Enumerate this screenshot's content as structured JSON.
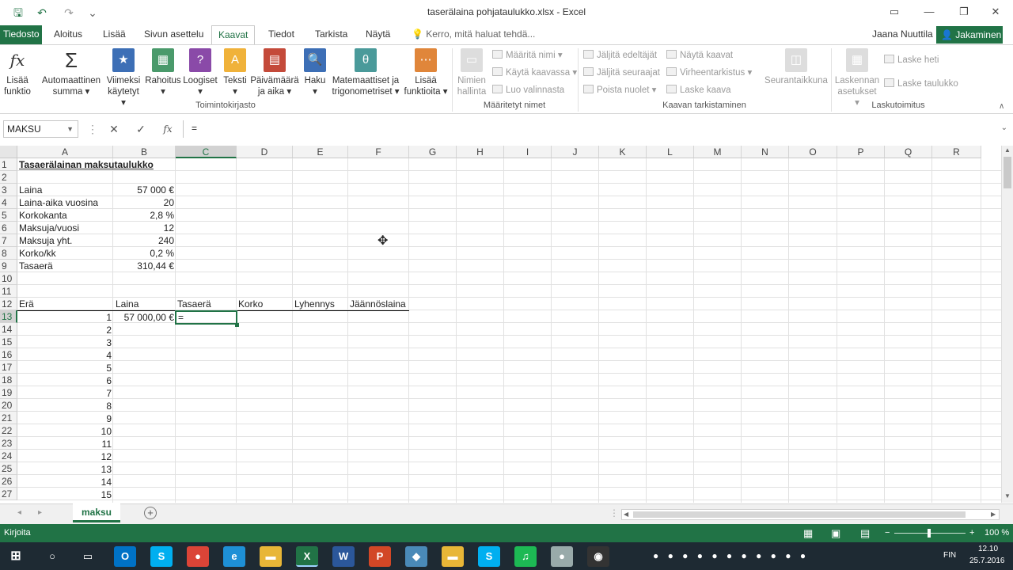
{
  "window": {
    "title": "taserälaina pohjataulukko.xlsx - Excel",
    "minimize": "—",
    "restore": "❐",
    "close": "✕",
    "ribbon_options": "▭"
  },
  "quick_access": {
    "save": "🖫",
    "undo": "↶",
    "redo": "↷",
    "customize": "⌄"
  },
  "tabs": [
    "Tiedosto",
    "Aloitus",
    "Lisää",
    "Sivun asettelu",
    "Kaavat",
    "Tiedot",
    "Tarkista",
    "Näytä"
  ],
  "active_tab": "Kaavat",
  "tell_me": "Kerro, mitä haluat tehdä...",
  "user": "Jaana Nuuttila",
  "share": "Jakaminen",
  "ribbon": {
    "insert_function": [
      "Lisää",
      "funktio"
    ],
    "lib": [
      [
        "Automaattinen",
        "summa ▾"
      ],
      [
        "Viimeksi",
        "käytetyt ▾"
      ],
      [
        "Rahoitus",
        "▾"
      ],
      [
        "Loogiset",
        "▾"
      ],
      [
        "Teksti",
        "▾"
      ],
      [
        "Päivämäärä",
        "ja aika ▾"
      ],
      [
        "Haku",
        "▾"
      ],
      [
        "Matemaattiset ja",
        "trigonometriset ▾"
      ],
      [
        "Lisää",
        "funktioita ▾"
      ]
    ],
    "group_library": "Toimintokirjasto",
    "name_manager": [
      "Nimien",
      "hallinta"
    ],
    "defined_names": [
      "Määritä nimi ▾",
      "Käytä kaavassa ▾",
      "Luo valinnasta"
    ],
    "group_names": "Määritetyt nimet",
    "audit_left": [
      "Jäljitä edeltäjät",
      "Jäljitä seuraajat",
      "Poista nuolet ▾"
    ],
    "audit_right": [
      "Näytä kaavat",
      "Virheentarkistus ▾",
      "Laske kaava"
    ],
    "watch": "Seurantaikkuna",
    "group_audit": "Kaavan tarkistaminen",
    "calc_options": [
      "Laskennan",
      "asetukset ▾"
    ],
    "calc": [
      "Laske heti",
      "Laske taulukko"
    ],
    "group_calc": "Laskutoimitus"
  },
  "formula_bar": {
    "name_box": "MAKSU",
    "formula": "="
  },
  "columns": [
    "A",
    "B",
    "C",
    "D",
    "E",
    "F",
    "G",
    "H",
    "I",
    "J",
    "K",
    "L",
    "M",
    "N",
    "O",
    "P",
    "Q",
    "R"
  ],
  "rows": [
    "1",
    "2",
    "3",
    "4",
    "5",
    "6",
    "7",
    "8",
    "9",
    "10",
    "11",
    "12",
    "13",
    "14",
    "15",
    "16",
    "17",
    "18",
    "19",
    "20",
    "21",
    "22",
    "23",
    "24",
    "25",
    "26",
    "27"
  ],
  "cells": {
    "title": "Tasaerälainan maksutaulukko",
    "params": [
      {
        "label": "Laina",
        "value": "57 000 €"
      },
      {
        "label": "Laina-aika vuosina",
        "value": "20"
      },
      {
        "label": "Korkokanta",
        "value": "2,8 %"
      },
      {
        "label": "Maksuja/vuosi",
        "value": "12"
      },
      {
        "label": "Maksuja yht.",
        "value": "240"
      },
      {
        "label": "Korko/kk",
        "value": "0,2 %"
      },
      {
        "label": "Tasaerä",
        "value": "310,44 €"
      }
    ],
    "headers": [
      "Erä",
      "Laina",
      "Tasaerä",
      "Korko",
      "Lyhennys",
      "Jäännöslaina"
    ],
    "first_loan": "57 000,00 €",
    "editing": "=",
    "erat": [
      "1",
      "2",
      "3",
      "4",
      "5",
      "6",
      "7",
      "8",
      "9",
      "10",
      "11",
      "12",
      "13",
      "14",
      "15"
    ]
  },
  "sheet_tab": "maksu",
  "status": {
    "mode": "Kirjoita",
    "zoom": "100 %"
  },
  "taskbar": {
    "apps": [
      {
        "name": "outlook",
        "label": "O",
        "color": "#0072c6"
      },
      {
        "name": "skype",
        "label": "S",
        "color": "#00aff0"
      },
      {
        "name": "chrome",
        "label": "●",
        "color": "#db4437"
      },
      {
        "name": "edge",
        "label": "e",
        "color": "#1e90d6"
      },
      {
        "name": "explorer",
        "label": "▬",
        "color": "#e8b637"
      },
      {
        "name": "excel",
        "label": "X",
        "color": "#217346"
      },
      {
        "name": "word",
        "label": "W",
        "color": "#2b579a"
      },
      {
        "name": "powerpoint",
        "label": "P",
        "color": "#d24726"
      },
      {
        "name": "app",
        "label": "◆",
        "color": "#4a8ab8"
      },
      {
        "name": "folder",
        "label": "▬",
        "color": "#e8b637"
      },
      {
        "name": "skype2",
        "label": "S",
        "color": "#00aff0"
      },
      {
        "name": "spotify",
        "label": "♫",
        "color": "#1db954"
      },
      {
        "name": "app2",
        "label": "●",
        "color": "#9aa"
      },
      {
        "name": "obs",
        "label": "◉",
        "color": "#333"
      }
    ],
    "lang": "FIN",
    "time": "12.10",
    "date": "25.7.2016"
  }
}
